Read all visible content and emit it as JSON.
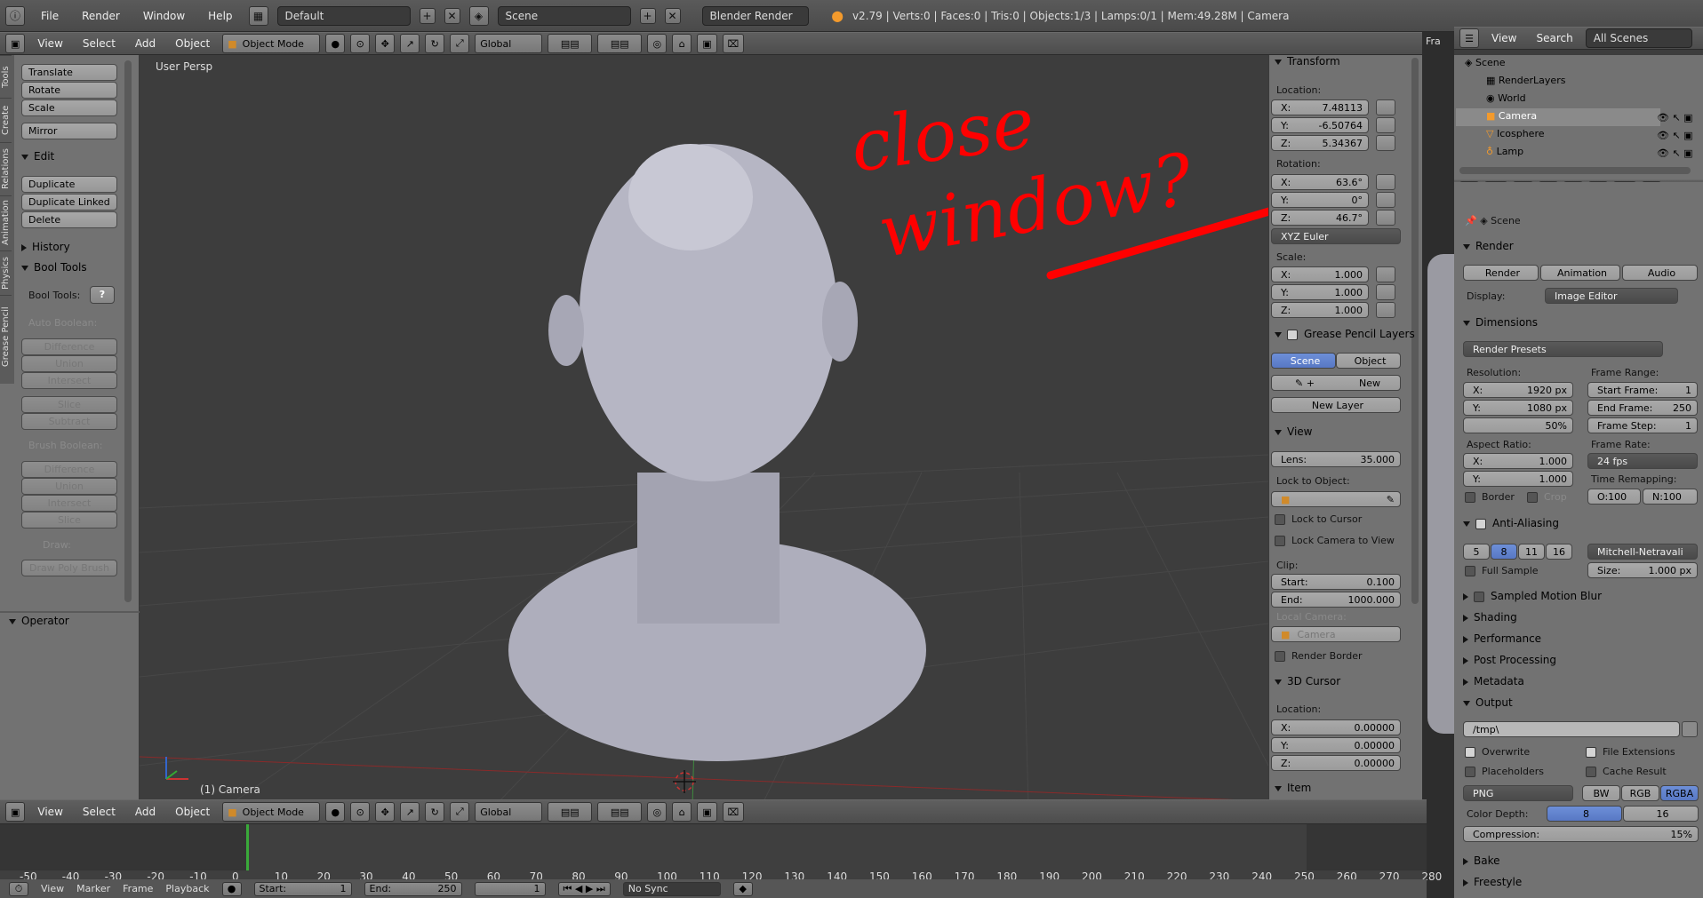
{
  "infobar": {
    "menus": [
      "File",
      "Render",
      "Window",
      "Help"
    ],
    "screen_layout": "Default",
    "scene": "Scene",
    "engine": "Blender Render",
    "stats": "v2.79 | Verts:0 | Faces:0 | Tris:0 | Objects:1/3 | Lamps:0/1 | Mem:49.28M | Camera"
  },
  "header": {
    "menus": [
      "View",
      "Select",
      "Add",
      "Object"
    ],
    "mode": "Object Mode",
    "orientation": "Global"
  },
  "toolshelf": {
    "tabs": [
      "Tools",
      "Create",
      "Relations",
      "Animation",
      "Physics",
      "Grease Pencil"
    ],
    "transform_buttons": [
      "Translate",
      "Rotate",
      "Scale"
    ],
    "mirror": "Mirror",
    "edit_header": "Edit",
    "edit_buttons": [
      "Duplicate",
      "Duplicate Linked",
      "Delete"
    ],
    "history_header": "History",
    "bool_header": "Bool Tools",
    "bool_tools_label": "Bool Tools:",
    "auto_boolean": "Auto Boolean:",
    "auto_ops": [
      "Difference",
      "Union",
      "Intersect"
    ],
    "auto_ops2": [
      "Slice",
      "Subtract"
    ],
    "brush_boolean": "Brush Boolean:",
    "brush_ops": [
      "Difference",
      "Union",
      "Intersect",
      "Slice"
    ],
    "draw_label": "Draw:",
    "draw_poly": "Draw Poly Brush",
    "operator_header": "Operator"
  },
  "viewport": {
    "view_label": "User Persp",
    "object_label": "(1) Camera",
    "annotation_line1": "close",
    "annotation_line2": "window?"
  },
  "npanel": {
    "transform": "Transform",
    "location_label": "Location:",
    "loc": [
      [
        "X:",
        "7.48113"
      ],
      [
        "Y:",
        "-6.50764"
      ],
      [
        "Z:",
        "5.34367"
      ]
    ],
    "rotation_label": "Rotation:",
    "rot": [
      [
        "X:",
        "63.6°"
      ],
      [
        "Y:",
        "0°"
      ],
      [
        "Z:",
        "46.7°"
      ]
    ],
    "rot_mode": "XYZ Euler",
    "scale_label": "Scale:",
    "scale": [
      [
        "X:",
        "1.000"
      ],
      [
        "Y:",
        "1.000"
      ],
      [
        "Z:",
        "1.000"
      ]
    ],
    "gp_layers": "Grease Pencil Layers",
    "gp_scene": "Scene",
    "gp_object": "Object",
    "gp_new": "New",
    "gp_new_layer": "New Layer",
    "view": "View",
    "lens": [
      "Lens:",
      "35.000"
    ],
    "lock_to_object": "Lock to Object:",
    "lock_to_cursor": "Lock to Cursor",
    "lock_camera": "Lock Camera to View",
    "clip": "Clip:",
    "clip_start": [
      "Start:",
      "0.100"
    ],
    "clip_end": [
      "End:",
      "1000.000"
    ],
    "local_camera": "Local Camera:",
    "camera_field": "Camera",
    "render_border": "Render Border",
    "cursor3d": "3D Cursor",
    "cursor_location": "Location:",
    "cursor": [
      [
        "X:",
        "0.00000"
      ],
      [
        "Y:",
        "0.00000"
      ],
      [
        "Z:",
        "0.00000"
      ]
    ],
    "item": "Item"
  },
  "outliner": {
    "menus": [
      "View",
      "Search"
    ],
    "filter": "All Scenes",
    "rows": [
      "Scene",
      "RenderLayers",
      "World",
      "Camera",
      "Icosphere",
      "Lamp"
    ]
  },
  "properties": {
    "scene": "Scene",
    "render": "Render",
    "render_btns": [
      "Render",
      "Animation",
      "Audio"
    ],
    "display_label": "Display:",
    "display_value": "Image Editor",
    "dimensions": "Dimensions",
    "presets": "Render Presets",
    "resolution": "Resolution:",
    "res_x": [
      "X:",
      "1920 px"
    ],
    "res_y": [
      "Y:",
      "1080 px"
    ],
    "res_pct": "50%",
    "frame_range": "Frame Range:",
    "start_frame": [
      "Start Frame:",
      "1"
    ],
    "end_frame": [
      "End Frame:",
      "250"
    ],
    "frame_step": [
      "Frame Step:",
      "1"
    ],
    "aspect": "Aspect Ratio:",
    "asp_x": [
      "X:",
      "1.000"
    ],
    "asp_y": [
      "Y:",
      "1.000"
    ],
    "frame_rate": "Frame Rate:",
    "fps": "24 fps",
    "time_remap": "Time Remapping:",
    "remap_old": "O:100",
    "remap_new": "N:100",
    "border": "Border",
    "crop": "Crop",
    "aa": "Anti-Aliasing",
    "aa_samples": [
      "5",
      "8",
      "11",
      "16"
    ],
    "aa_filter": "Mitchell-Netravali",
    "full_sample": "Full Sample",
    "size": [
      "Size:",
      "1.000 px"
    ],
    "motion_blur": "Sampled Motion Blur",
    "collapsed": [
      "Shading",
      "Performance",
      "Post Processing",
      "Metadata"
    ],
    "output": "Output",
    "path": "/tmp\\",
    "overwrite": "Overwrite",
    "file_ext": "File Extensions",
    "placeholders": "Placeholders",
    "cache": "Cache Result",
    "format": "PNG",
    "color_modes": [
      "BW",
      "RGB",
      "RGBA"
    ],
    "color_depth": "Color Depth:",
    "depths": [
      "8",
      "16"
    ],
    "compression": "Compression:",
    "compression_val": "15%",
    "bake": "Bake",
    "freestyle": "Freestyle"
  },
  "timeline": {
    "ticks": [
      "-50",
      "-40",
      "-30",
      "-20",
      "-10",
      "0",
      "10",
      "20",
      "30",
      "40",
      "50",
      "60",
      "70",
      "80",
      "90",
      "100",
      "110",
      "120",
      "130",
      "140",
      "150",
      "160",
      "170",
      "180",
      "190",
      "200",
      "210",
      "220",
      "230",
      "240",
      "250",
      "260",
      "270",
      "280"
    ],
    "footer_menus": [
      "View",
      "Marker",
      "Frame",
      "Playback"
    ],
    "start": [
      "Start:",
      "1"
    ],
    "end": [
      "End:",
      "250"
    ],
    "current": "1",
    "sync": "No Sync"
  },
  "strip_label": "Fra"
}
